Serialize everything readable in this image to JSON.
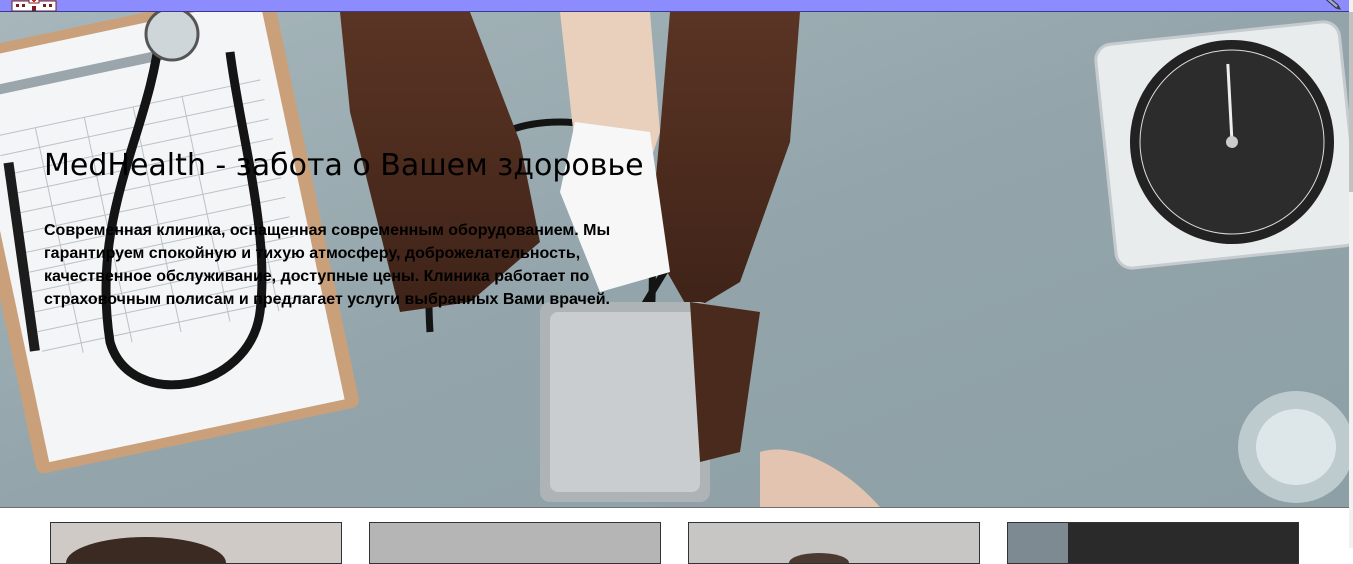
{
  "header": {
    "logo_icon": "hospital-building-icon",
    "menu_icon": "pencil-icon",
    "bar_color": "#8c8cff"
  },
  "hero": {
    "title": "MedHealth - забота о Вашем здоровье",
    "description": "Современная клиника, оснащенная современным оборудованием. Мы гарантируем спокойную и тихую атмосферу, доброжелательность, качественное обслуживание, доступные цены. Клиника работает по страховочным полисам и предлагает услуги выбранных Вами врачей."
  },
  "cards": [
    {
      "image": "doctor-photo-1"
    },
    {
      "image": "doctor-photo-2"
    },
    {
      "image": "doctor-photo-3"
    },
    {
      "image": "doctor-photo-4"
    }
  ]
}
